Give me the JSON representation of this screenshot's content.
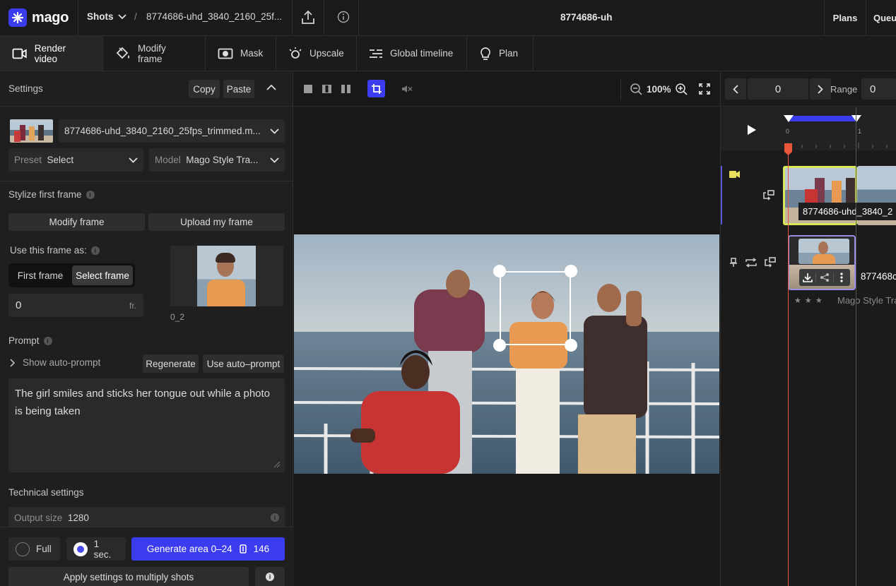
{
  "app": {
    "logo_text": "mago"
  },
  "topbar": {
    "shots_label": "Shots",
    "breadcrumb_sep": "/",
    "breadcrumb_file": "8774686-uhd_3840_2160_25f...",
    "center_title": "8774686-uh",
    "plans_label": "Plans",
    "queue_label": "Queu"
  },
  "toolbar": {
    "tabs": [
      {
        "label": "Render video",
        "icon": "video-camera-icon"
      },
      {
        "label": "Modify frame",
        "icon": "paint-bucket-icon"
      },
      {
        "label": "Mask",
        "icon": "mask-icon"
      },
      {
        "label": "Upscale",
        "icon": "upscale-icon"
      },
      {
        "label": "Global timeline",
        "icon": "timeline-icon"
      },
      {
        "label": "Plan",
        "icon": "lightbulb-icon"
      }
    ]
  },
  "settings": {
    "header": "Settings",
    "copy_label": "Copy",
    "paste_label": "Paste",
    "source_file": "8774686-uhd_3840_2160_25fps_trimmed.m...",
    "preset_label": "Preset",
    "preset_value": "Select",
    "model_label": "Model",
    "model_value": "Mago Style Tra...",
    "stylize_title": "Stylize first frame",
    "modify_frame_btn": "Modify frame",
    "upload_frame_btn": "Upload my frame",
    "use_frame_as": "Use this frame as:",
    "first_frame_opt": "First frame",
    "select_frame_opt": "Select frame",
    "frame_value": "0",
    "frame_unit": "fr.",
    "thumb_caption": "0_2",
    "prompt_title": "Prompt",
    "show_auto_prompt": "Show auto-prompt",
    "regenerate_btn": "Regenerate",
    "use_auto_prompt_btn": "Use auto–prompt",
    "prompt_text": "The girl smiles and sticks her tongue out while a photo is being taken",
    "technical_title": "Technical settings",
    "output_size_label": "Output size",
    "output_size_value": "1280",
    "full_label": "Full",
    "one_sec_label": "1 sec.",
    "generate_label": "Generate area 0–24",
    "generate_credits": "146",
    "apply_label": "Apply settings to multiply shots"
  },
  "viewer": {
    "zoom": "100%"
  },
  "timeline": {
    "frame_value": "0",
    "range_label": "Range",
    "range_value": "0",
    "tick_0": "0",
    "tick_1": "1",
    "clip_label": "8774686-uhd_3840_2",
    "shot_label": "877468с",
    "model_caption": "Mago Style Tra",
    "stars": "★ ★ ★"
  },
  "colors": {
    "accent": "#3b3bf0",
    "playhead": "#e8573a",
    "clip_highlight": "#d8e85a",
    "shot_border": "#9c8fe6"
  }
}
